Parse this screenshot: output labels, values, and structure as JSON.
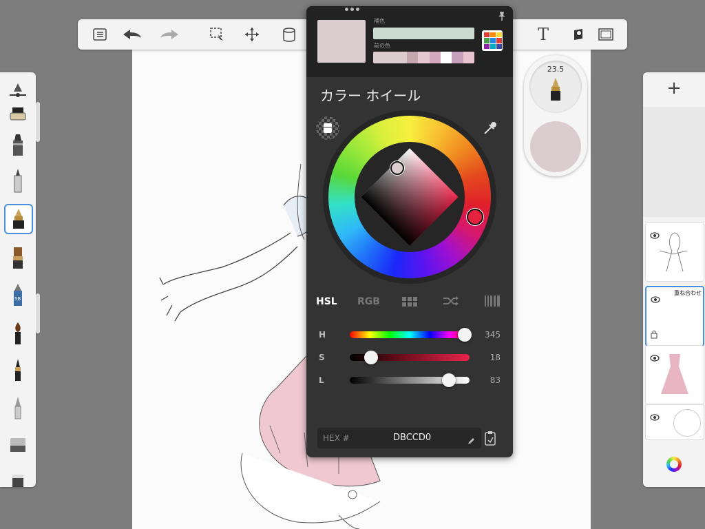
{
  "toolbar": {
    "left_icons": [
      "list-icon",
      "undo-icon",
      "redo-icon",
      "selection-icon",
      "transform-icon",
      "fill-bucket-icon"
    ],
    "right_icons": [
      "text-icon",
      "stencil-icon",
      "fullscreen-icon"
    ],
    "text_tool_label": "T"
  },
  "left_tools": [
    "ruler-icon",
    "airbrush-icon",
    "marker-icon",
    "ballpoint-icon",
    "inking-pen-icon",
    "brush-icon",
    "pencil-icon",
    "paintbrush-icon",
    "ink-brush-icon",
    "smudge-icon",
    "eraser-icon",
    "fill-icon"
  ],
  "left_tools_selected": 4,
  "pencil_label": "5B",
  "colors": {
    "current": "#DBCCD0",
    "complementary": "#CCDBD0",
    "accent": "#4a90e2",
    "history": [
      "#DBCCD0",
      "#C4A7AF",
      "#E6C8D2",
      "#D4A9BE",
      "#FFFFFF",
      "#C7A0BC",
      "#E8C4D0"
    ]
  },
  "color_panel": {
    "label_complementary": "補色",
    "label_previous": "前の色",
    "title": "カラー ホイール",
    "tabs": {
      "hsl": "HSL",
      "rgb": "RGB"
    },
    "sliders": [
      {
        "label": "H",
        "value": "345",
        "fraction": 0.96
      },
      {
        "label": "S",
        "value": "18",
        "fraction": 0.18
      },
      {
        "label": "L",
        "value": "83",
        "fraction": 0.83
      }
    ],
    "hex_label": "HEX #",
    "hex_value": "DBCCD0"
  },
  "brush_panel": {
    "size": "23.5"
  },
  "layers": {
    "add_label": "+",
    "blend_mode_label": "重ね合わせ"
  }
}
